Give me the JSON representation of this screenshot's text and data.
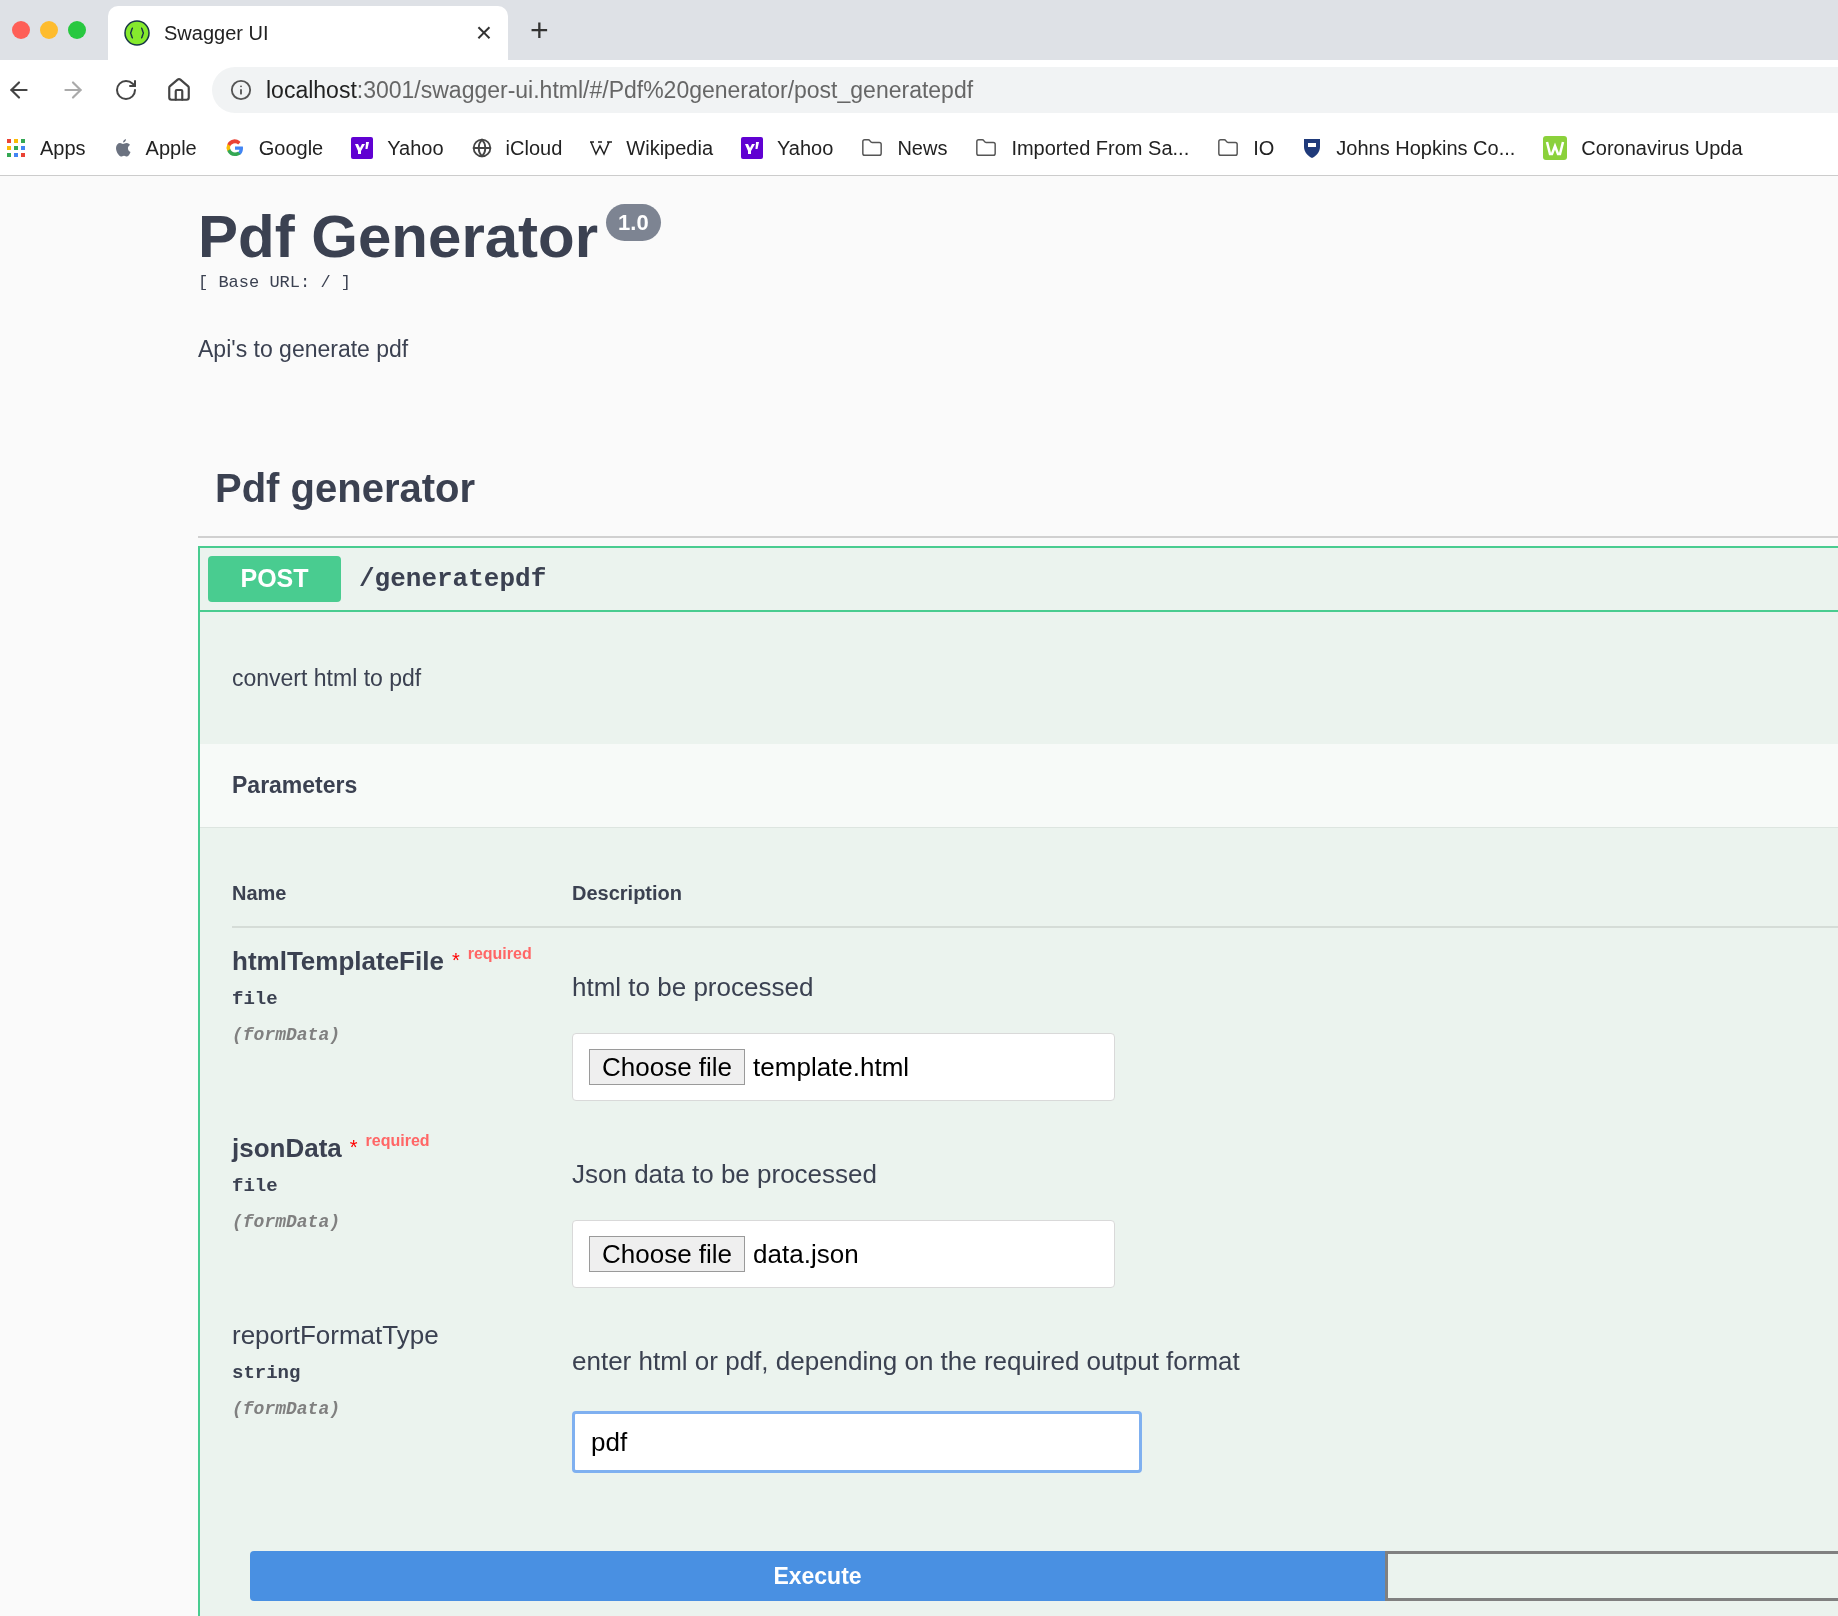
{
  "browser": {
    "tab": {
      "title": "Swagger UI",
      "close": "×"
    },
    "new_tab": "+",
    "url": {
      "host": "localhost",
      "rest": ":3001/swagger-ui.html/#/Pdf%20generator/post_generatepdf"
    },
    "bookmarks": [
      {
        "kind": "apps",
        "label": "Apps"
      },
      {
        "kind": "apple",
        "label": "Apple"
      },
      {
        "kind": "google",
        "label": "Google"
      },
      {
        "kind": "yahoo",
        "label": "Yahoo"
      },
      {
        "kind": "globe",
        "label": "iCloud"
      },
      {
        "kind": "wiki",
        "label": "Wikipedia"
      },
      {
        "kind": "yahoo",
        "label": "Yahoo"
      },
      {
        "kind": "folder",
        "label": "News"
      },
      {
        "kind": "folder",
        "label": "Imported From Sa..."
      },
      {
        "kind": "folder",
        "label": "IO"
      },
      {
        "kind": "shield",
        "label": "Johns Hopkins Co..."
      },
      {
        "kind": "wbox",
        "label": "Coronavirus Upda"
      }
    ]
  },
  "info": {
    "title": "Pdf Generator",
    "version": "1.0",
    "base_url": "[ Base URL: / ]",
    "description": "Api's to generate pdf"
  },
  "section": {
    "title": "Pdf generator"
  },
  "operation": {
    "method": "POST",
    "path": "/generatepdf",
    "summary": "convert html to pdf",
    "parameters_title": "Parameters",
    "columns": [
      "Name",
      "Description"
    ],
    "parameters": [
      {
        "kind": "file",
        "name": "htmlTemplateFile",
        "required": true,
        "required_mark": "*",
        "required_label": "required",
        "type": "file",
        "location": "(formData)",
        "description": "html to be processed",
        "button": "Choose file",
        "value": "template.html"
      },
      {
        "kind": "file",
        "name": "jsonData",
        "required": true,
        "required_mark": "*",
        "required_label": "required",
        "type": "file",
        "location": "(formData)",
        "description": "Json data to be processed",
        "button": "Choose file",
        "value": "data.json"
      },
      {
        "kind": "text",
        "name": "reportFormatType",
        "required": false,
        "type": "string",
        "location": "(formData)",
        "description": "enter html or pdf, depending on the required output format",
        "value": "pdf"
      }
    ],
    "execute": "Execute"
  }
}
